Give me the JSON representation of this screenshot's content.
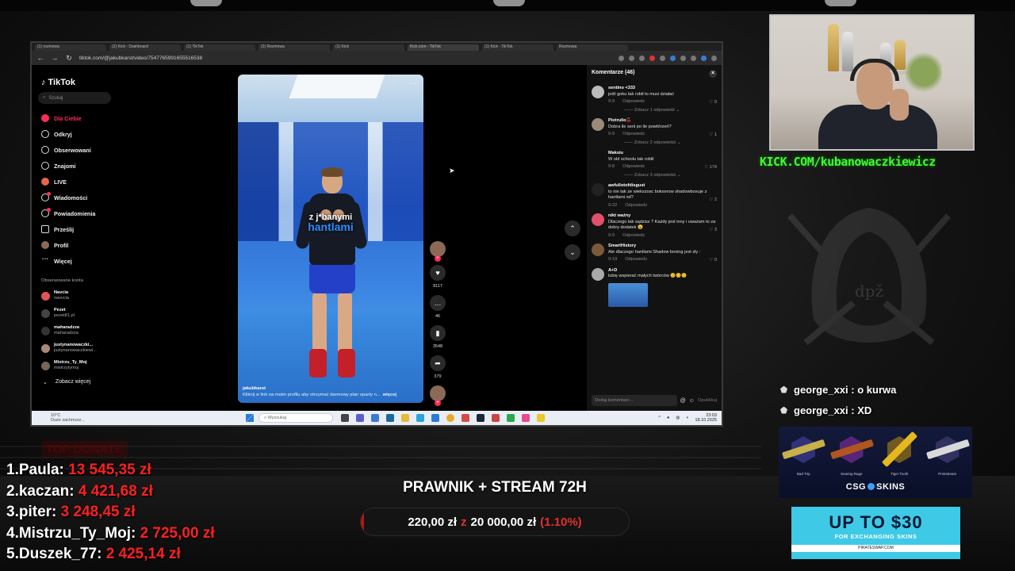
{
  "browser": {
    "tabs": [
      "(1) rozmowa",
      "(2) Kick - Dashboard",
      "(1) TikTok",
      "(2) Rozmowa",
      "(1) Kick",
      "Kick.com - TikTok",
      "(1) Kick - TikTok",
      "Rozmowa"
    ],
    "url": "tiktok.com/@jakubkarst/video/7547765991655516538"
  },
  "tiktok": {
    "logo": "TikTok",
    "search_placeholder": "Szukaj",
    "menu": [
      {
        "label": "Dla Ciebie",
        "icon": "home-icon"
      },
      {
        "label": "Odkryj",
        "icon": "compass-icon"
      },
      {
        "label": "Obserwowani",
        "icon": "following-icon"
      },
      {
        "label": "Znajomi",
        "icon": "friends-icon"
      },
      {
        "label": "LIVE",
        "icon": "live-icon"
      },
      {
        "label": "Wiadomości",
        "icon": "messages-icon"
      },
      {
        "label": "Powiadomienia",
        "icon": "notifications-icon"
      },
      {
        "label": "Prześlij",
        "icon": "upload-icon"
      },
      {
        "label": "Profil",
        "icon": "profile-icon"
      },
      {
        "label": "Więcej",
        "icon": "more-icon"
      }
    ],
    "followed_title": "Obserwowane konta",
    "followed": [
      {
        "name": "Navcia",
        "user": "navvcia"
      },
      {
        "name": "Pezet",
        "user": "pezet81.pl"
      },
      {
        "name": "maharadzza",
        "user": "maharadzza"
      },
      {
        "name": "justynanowaczki...",
        "user": "justynanowaczkiewi..."
      },
      {
        "name": "Mistrzu_Ty_Moj",
        "user": "mistrzytymoj"
      }
    ],
    "see_more": "Zobacz więcej",
    "video": {
      "overlay_line1": "z j*banymi",
      "overlay_line2": "hantlami",
      "author": "jakubkarst",
      "description": "Kliknij w link na moim profilu aby otrzymać darmowy plan oparty n...",
      "more": "więcej"
    },
    "actions": {
      "likes": "8117",
      "comments": "46",
      "saves": "3548",
      "shares": "379"
    },
    "comments_header": "Komentarze (46)",
    "comments": [
      {
        "user": "sentino <333",
        "text": "jeśli goku tak robił to musi działać",
        "date": "9-9",
        "reply": "Odpowiedz",
        "likes": "9",
        "replies": "Zobacz 1 odpowiedź"
      },
      {
        "user": "Piotrulio🍒",
        "text": "Dobra ile serii po ile powtórzeń?",
        "date": "9-9",
        "reply": "Odpowiedz",
        "likes": "1",
        "replies": "Zobacz 2 odpowiedzi"
      },
      {
        "user": "Maksiu",
        "text": "W old schoolu tak robili",
        "date": "9-8",
        "reply": "Odpowiedz",
        "likes": "174",
        "replies": "Zobacz 3 odpowiedzi"
      },
      {
        "user": "awfullotofdisgust",
        "text": "to nie tak ze wiekszosc bokserow shadowboxuje z hantlami xd?",
        "date": "9-22",
        "reply": "Odpowiedz",
        "likes": "2",
        "replies": ""
      },
      {
        "user": "nikt ważny",
        "text": "Dlaczego tak sądzisz ? Każdy jest inny i uważam to za dobry dodatek 😮",
        "date": "9-9",
        "reply": "Odpowiedz",
        "likes": "3",
        "replies": ""
      },
      {
        "user": "SmartHistory",
        "text": "Ale dlaczego hantlami Shadow boxing jest zły :",
        "date": "9-19",
        "reply": "Odpowiedz",
        "likes": "0",
        "replies": ""
      },
      {
        "user": "A+D",
        "text": "lubię wspierać małych twórców 😊😊😊",
        "date": "",
        "reply": "",
        "likes": "",
        "replies": ""
      }
    ],
    "comment_placeholder": "Dodaj komentarz...",
    "post_label": "Opublikuj"
  },
  "taskbar": {
    "weather_temp": "10°C",
    "weather_desc": "Duże zachmurz...",
    "search": "Wyszukaj",
    "time": "23:03",
    "date": "18.10.2025"
  },
  "overlay": {
    "kick_url": "KICK.COM/kubanowaczkiewicz",
    "emblem_text": "dpž",
    "chat": [
      {
        "user": "george_xxi",
        "message": "o kurwa"
      },
      {
        "user": "george_xxi",
        "message": "XD"
      }
    ],
    "skins": [
      {
        "name": "Bad Trip",
        "color": "#c8b04a"
      },
      {
        "name": "Searing Rage",
        "color": "#b0561e"
      },
      {
        "name": "Tiger Tooth",
        "color": "#e5b820"
      },
      {
        "name": "Printstream",
        "color": "#d9d9d9"
      }
    ],
    "skins_logo_left": "CSG",
    "skins_logo_right": "SKINS",
    "promo_big": "UP TO $30",
    "promo_sub": "FOR EXCHANGING SKINS",
    "promo_domain": "PIRATESWAP.COM",
    "top_donate_title": "TOP DONATE",
    "donors": [
      {
        "rank": "1.",
        "name": "Paula:",
        "amount": "13 545,35 zł"
      },
      {
        "rank": "2.",
        "name": "kaczan:",
        "amount": "4 421,68 zł"
      },
      {
        "rank": "3.",
        "name": "piter:",
        "amount": "3 248,45 zł"
      },
      {
        "rank": "4.",
        "name": "Mistrzu_Ty_Moj:",
        "amount": "2 725,00 zł"
      },
      {
        "rank": "5.",
        "name": "Duszek_77:",
        "amount": "2 425,14 zł"
      }
    ],
    "goal": {
      "title": "PRAWNIK + STREAM 72H",
      "current": "220,00 zł",
      "sep": "z",
      "target": "20 000,00 zł",
      "percent": "(1.10%)",
      "fraction": 0.011
    }
  }
}
